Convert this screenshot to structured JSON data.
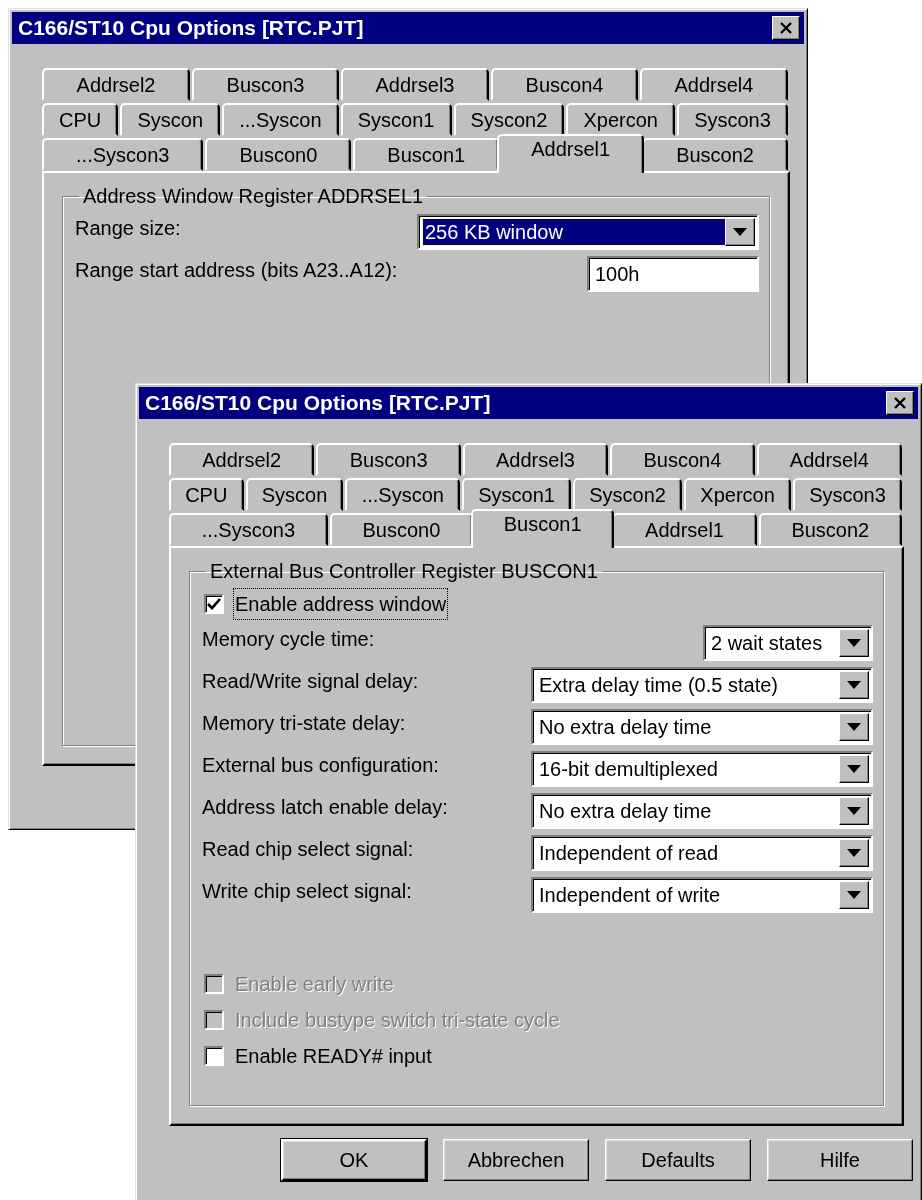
{
  "windows": [
    {
      "title": "C166/ST10 Cpu Options [RTC.PJT]",
      "tab_rows": [
        [
          {
            "label": "Addrsel2",
            "selected": false
          },
          {
            "label": "Buscon3",
            "selected": false
          },
          {
            "label": "Addrsel3",
            "selected": false
          },
          {
            "label": "Buscon4",
            "selected": false
          },
          {
            "label": "Addrsel4",
            "selected": false
          }
        ],
        [
          {
            "label": "CPU",
            "selected": false
          },
          {
            "label": "Syscon",
            "selected": false
          },
          {
            "label": "...Syscon",
            "selected": false
          },
          {
            "label": "Syscon1",
            "selected": false
          },
          {
            "label": "Syscon2",
            "selected": false
          },
          {
            "label": "Xpercon",
            "selected": false
          },
          {
            "label": "Syscon3",
            "selected": false
          }
        ],
        [
          {
            "label": "...Syscon3",
            "selected": false
          },
          {
            "label": "Buscon0",
            "selected": false
          },
          {
            "label": "Buscon1",
            "selected": false
          },
          {
            "label": "Addrsel1",
            "selected": true
          },
          {
            "label": "Buscon2",
            "selected": false
          }
        ]
      ],
      "group_title": "Address Window Register ADDRSEL1",
      "controls": [
        {
          "kind": "combo",
          "label": "Range size:",
          "value": "256 KB window",
          "focused": true
        },
        {
          "kind": "text",
          "label": "Range start address (bits A23..A12):",
          "value": "100h",
          "focused": false
        }
      ]
    },
    {
      "title": "C166/ST10 Cpu Options [RTC.PJT]",
      "tab_rows": [
        [
          {
            "label": "Addrsel2",
            "selected": false
          },
          {
            "label": "Buscon3",
            "selected": false
          },
          {
            "label": "Addrsel3",
            "selected": false
          },
          {
            "label": "Buscon4",
            "selected": false
          },
          {
            "label": "Addrsel4",
            "selected": false
          }
        ],
        [
          {
            "label": "CPU",
            "selected": false
          },
          {
            "label": "Syscon",
            "selected": false
          },
          {
            "label": "...Syscon",
            "selected": false
          },
          {
            "label": "Syscon1",
            "selected": false
          },
          {
            "label": "Syscon2",
            "selected": false
          },
          {
            "label": "Xpercon",
            "selected": false
          },
          {
            "label": "Syscon3",
            "selected": false
          }
        ],
        [
          {
            "label": "...Syscon3",
            "selected": false
          },
          {
            "label": "Buscon0",
            "selected": false
          },
          {
            "label": "Buscon1",
            "selected": true
          },
          {
            "label": "Addrsel1",
            "selected": false
          },
          {
            "label": "Buscon2",
            "selected": false
          }
        ]
      ],
      "group_title": "External Bus Controller Register BUSCON1",
      "controls": [
        {
          "kind": "checkbox",
          "label": "Enable address window",
          "checked": true,
          "disabled": false,
          "focused": true
        },
        {
          "kind": "combo-short",
          "label": "Memory cycle time:",
          "value": "2 wait states",
          "focused": false
        },
        {
          "kind": "combo",
          "label": "Read/Write signal delay:",
          "value": "Extra delay time (0.5 state)",
          "focused": false
        },
        {
          "kind": "combo",
          "label": "Memory tri-state delay:",
          "value": "No extra delay time",
          "focused": false
        },
        {
          "kind": "combo",
          "label": "External bus configuration:",
          "value": "16-bit demultiplexed",
          "focused": false
        },
        {
          "kind": "combo",
          "label": "Address latch enable delay:",
          "value": "No extra delay time",
          "focused": false
        },
        {
          "kind": "combo",
          "label": "Read chip select signal:",
          "value": "Independent of read",
          "focused": false
        },
        {
          "kind": "combo",
          "label": "Write chip select signal:",
          "value": "Independent of write",
          "focused": false
        },
        {
          "kind": "checkbox",
          "label": "Enable early write",
          "checked": false,
          "disabled": true,
          "focused": false
        },
        {
          "kind": "checkbox",
          "label": "Include bustype switch tri-state cycle",
          "checked": false,
          "disabled": true,
          "focused": false
        },
        {
          "kind": "checkbox",
          "label": "Enable READY# input",
          "checked": false,
          "disabled": false,
          "focused": false
        }
      ],
      "buttons": [
        {
          "label": "OK",
          "default": true
        },
        {
          "label": "Abbrechen",
          "default": false
        },
        {
          "label": "Defaults",
          "default": false
        },
        {
          "label": "Hilfe",
          "default": false
        }
      ]
    }
  ]
}
